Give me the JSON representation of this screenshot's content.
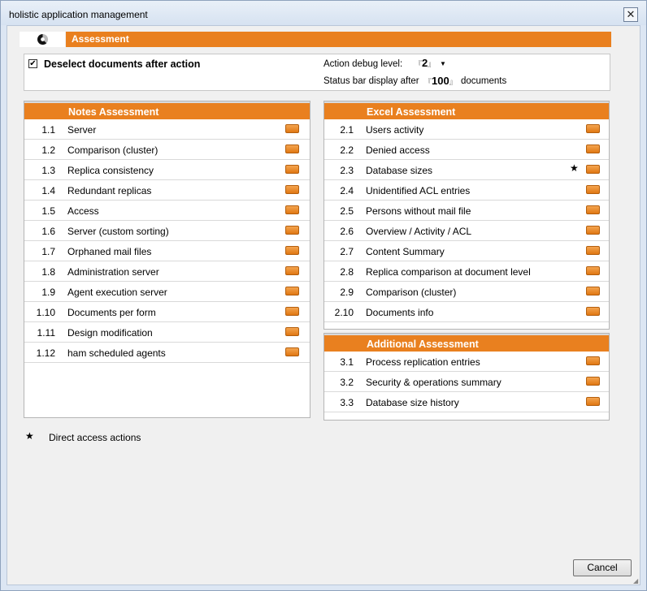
{
  "window": {
    "title": "holistic application management",
    "close_glyph": "✕"
  },
  "header": {
    "title": "Assessment",
    "logo_icon": "pie-logo-icon"
  },
  "options": {
    "deselect_label": "Deselect documents after action",
    "deselect_checked": true,
    "debug_label": "Action debug level:",
    "debug_value": "2",
    "status_label": "Status bar display after",
    "status_value": "100",
    "status_suffix": "documents"
  },
  "notes": {
    "title": "Notes Assessment",
    "items": [
      {
        "num": "1.1",
        "label": "Server"
      },
      {
        "num": "1.2",
        "label": "Comparison (cluster)"
      },
      {
        "num": "1.3",
        "label": "Replica consistency"
      },
      {
        "num": "1.4",
        "label": "Redundant replicas"
      },
      {
        "num": "1.5",
        "label": "Access"
      },
      {
        "num": "1.6",
        "label": "Server (custom sorting)"
      },
      {
        "num": "1.7",
        "label": "Orphaned mail files"
      },
      {
        "num": "1.8",
        "label": "Administration server"
      },
      {
        "num": "1.9",
        "label": "Agent execution server"
      },
      {
        "num": "1.10",
        "label": "Documents per form"
      },
      {
        "num": "1.11",
        "label": "Design modification"
      },
      {
        "num": "1.12",
        "label": "ham scheduled agents"
      }
    ]
  },
  "excel": {
    "title": "Excel Assessment",
    "items": [
      {
        "num": "2.1",
        "label": "Users activity"
      },
      {
        "num": "2.2",
        "label": "Denied access"
      },
      {
        "num": "2.3",
        "label": "Database sizes",
        "star": "★"
      },
      {
        "num": "2.4",
        "label": "Unidentified ACL entries"
      },
      {
        "num": "2.5",
        "label": "Persons without mail file"
      },
      {
        "num": "2.6",
        "label": "Overview / Activity / ACL"
      },
      {
        "num": "2.7",
        "label": "Content Summary"
      },
      {
        "num": "2.8",
        "label": "Replica comparison at document level"
      },
      {
        "num": "2.9",
        "label": "Comparison (cluster)"
      },
      {
        "num": "2.10",
        "label": "Documents info"
      }
    ]
  },
  "additional": {
    "title": "Additional Assessment",
    "items": [
      {
        "num": "3.1",
        "label": "Process replication entries"
      },
      {
        "num": "3.2",
        "label": "Security & operations summary"
      },
      {
        "num": "3.3",
        "label": "Database size history"
      }
    ]
  },
  "legend": {
    "star": "★",
    "text": "Direct access actions"
  },
  "footer": {
    "cancel_label": "Cancel"
  },
  "colors": {
    "accent": "#e9801f",
    "button": "#e07813"
  }
}
